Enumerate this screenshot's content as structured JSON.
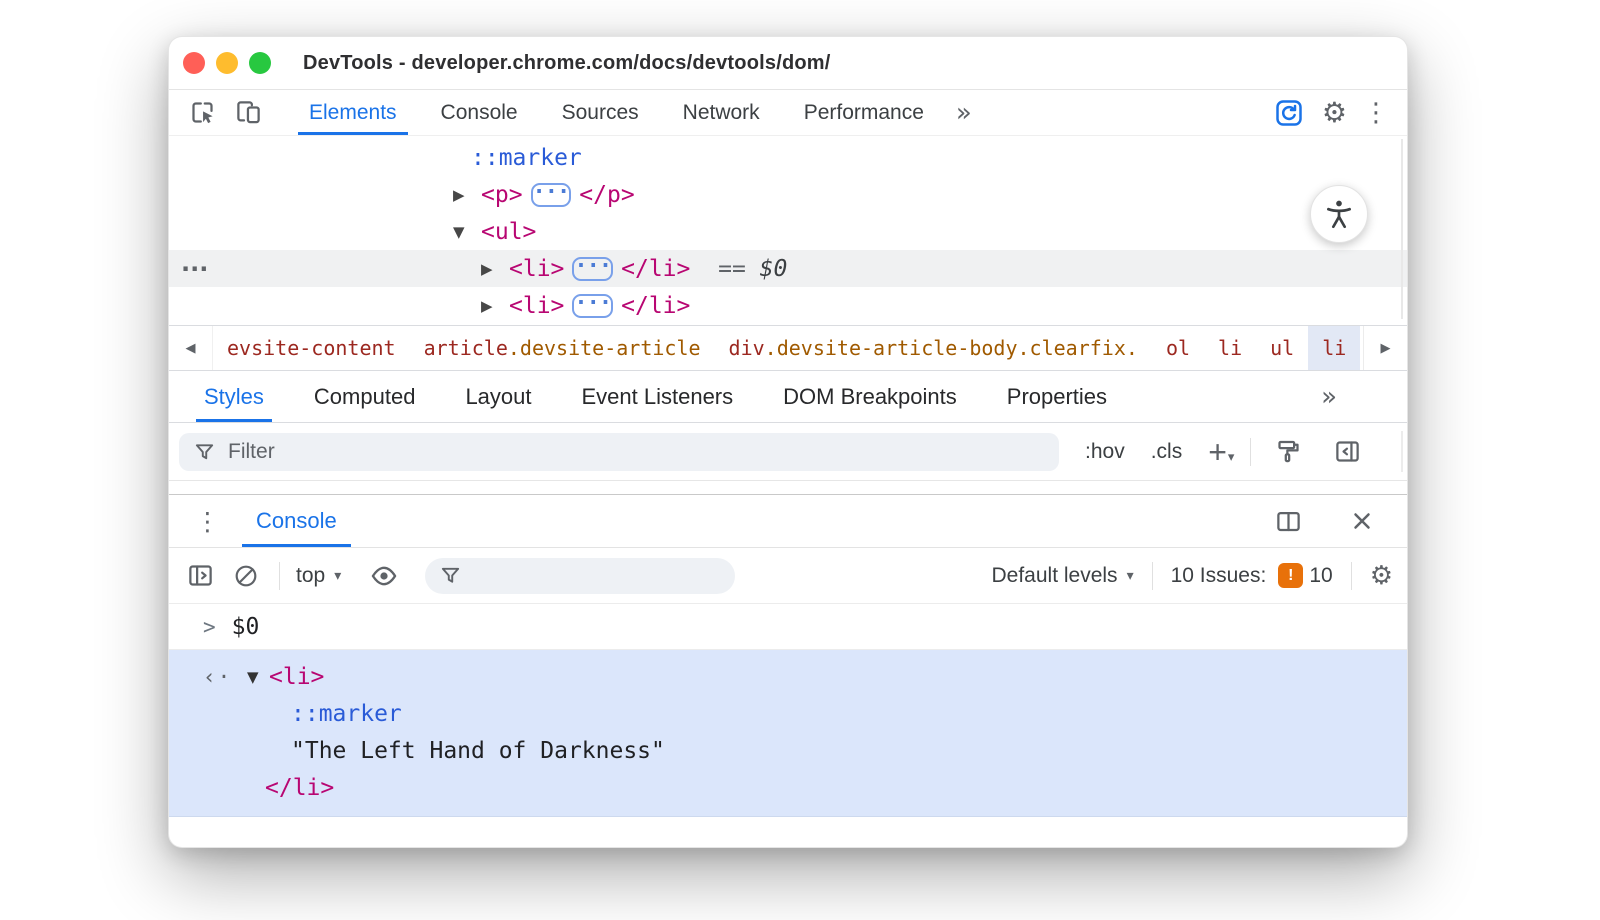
{
  "glyphs": {
    "gear": "⚙",
    "kebab": "⋮",
    "more_tabs": "»",
    "arrow_collapsed": "▶",
    "arrow_expanded": "▼",
    "crumb_prev": "◀",
    "crumb_next": "▶",
    "inline_expand_dots": "···",
    "row_overflow_dots": "···",
    "caret_down": "▾",
    "prompt_chevron": ">",
    "returned_value_marker": "‹·",
    "issues_badge_mark": "!"
  },
  "colors": {
    "accent_blue": "#1a73e8",
    "tag_pink": "#b80672",
    "pseudo_blue": "#2a5bd7",
    "crumb_tag_maroon": "#9c2820",
    "crumb_class_orange": "#a05a00",
    "issues_orange": "#e8710a",
    "console_selection_bg": "#dbe6fb",
    "selected_row_gray": "#f0f1f2",
    "traffic_red": "#ff5f57",
    "traffic_yellow": "#febc2e",
    "traffic_green": "#28c840"
  },
  "titlebar": {
    "title": "DevTools - developer.chrome.com/docs/devtools/dom/"
  },
  "main_toolbar": {
    "tabs": [
      {
        "label": "Elements"
      },
      {
        "label": "Console"
      },
      {
        "label": "Sources"
      },
      {
        "label": "Network"
      },
      {
        "label": "Performance"
      }
    ]
  },
  "elements_tree": {
    "rows": {
      "marker": {
        "text": "::marker"
      },
      "p": {
        "open": "<p>",
        "close": "</p>"
      },
      "ul": {
        "open": "<ul>"
      },
      "li_selected": {
        "open": "<li>",
        "close": "</li>",
        "eq": "==",
        "var": "$0"
      },
      "li2": {
        "open": "<li>",
        "close": "</li>"
      }
    }
  },
  "breadcrumb": {
    "items": [
      {
        "element": "evsite-content",
        "classes": ""
      },
      {
        "element": "article",
        "classes": ".devsite-article"
      },
      {
        "element": "div",
        "classes": ".devsite-article-body.clearfix."
      },
      {
        "element": "ol",
        "classes": ""
      },
      {
        "element": "li",
        "classes": ""
      },
      {
        "element": "ul",
        "classes": ""
      },
      {
        "element": "li",
        "classes": ""
      }
    ]
  },
  "styles_panel": {
    "tabs": [
      {
        "label": "Styles"
      },
      {
        "label": "Computed"
      },
      {
        "label": "Layout"
      },
      {
        "label": "Event Listeners"
      },
      {
        "label": "DOM Breakpoints"
      },
      {
        "label": "Properties"
      }
    ],
    "toolbar": {
      "filter_placeholder": "Filter",
      "hov_label": ":hov",
      "cls_label": ".cls",
      "plus_label": "+"
    }
  },
  "console_drawer": {
    "tab_label": "Console",
    "toolbar": {
      "context_label": "top",
      "default_levels_label": "Default levels",
      "issues_label": "10 Issues:",
      "issues_count": "10"
    },
    "prompt": {
      "expression": "$0"
    },
    "result": {
      "open_tag": "<li>",
      "marker": "::marker",
      "text_content": "\"The Left Hand of Darkness\"",
      "close_tag": "</li>"
    }
  }
}
